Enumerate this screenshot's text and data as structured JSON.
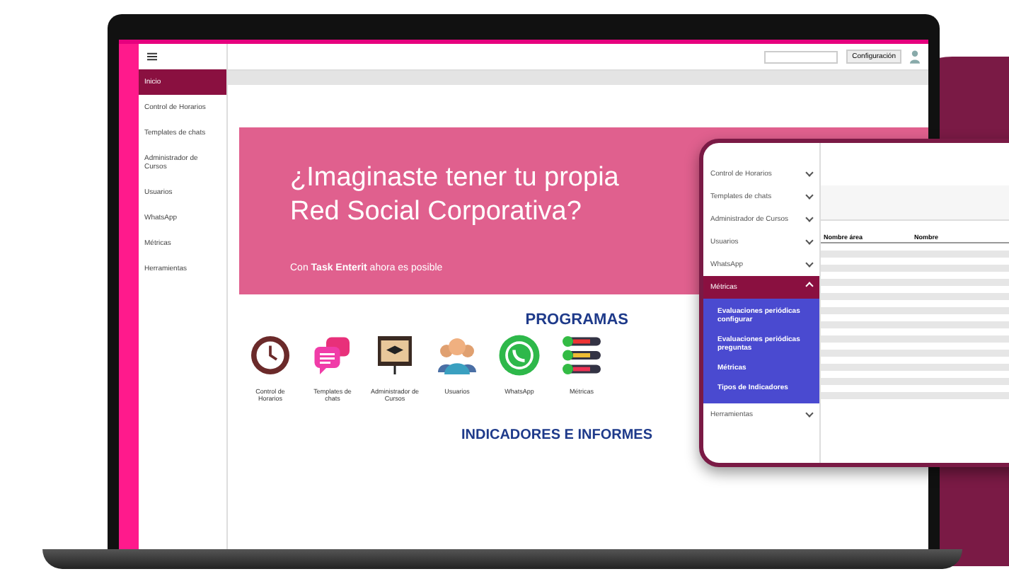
{
  "topbar": {
    "settings_button": "Configuración"
  },
  "sidebar": {
    "items": [
      {
        "label": "Inicio",
        "selected": true
      },
      {
        "label": "Control de Horarios",
        "selected": false
      },
      {
        "label": "Templates de chats",
        "selected": false
      },
      {
        "label": "Administrador de Cursos",
        "selected": false
      },
      {
        "label": "Usuarios",
        "selected": false
      },
      {
        "label": "WhatsApp",
        "selected": false
      },
      {
        "label": "Métricas",
        "selected": false
      },
      {
        "label": "Herramientas",
        "selected": false
      }
    ]
  },
  "banner": {
    "title": "¿Imaginaste tener tu propia Red Social Corporativa?",
    "subtitle": "Con **Task Enterit** ahora es posible"
  },
  "programs": {
    "heading": "PROGRAMAS",
    "items": [
      {
        "kind": "clock",
        "label": "Control de Horarios"
      },
      {
        "kind": "chat",
        "label": "Templates de chats"
      },
      {
        "kind": "course",
        "label": "Administrador de Cursos"
      },
      {
        "kind": "users",
        "label": "Usuarios"
      },
      {
        "kind": "whatsapp",
        "label": "WhatsApp"
      },
      {
        "kind": "metrics",
        "label": "Métricas"
      }
    ]
  },
  "indicators": {
    "heading": "INDICADORES E INFORMES"
  },
  "inset": {
    "menu": [
      {
        "label": "Control de Horarios",
        "expanded": false
      },
      {
        "label": "Templates de chats",
        "expanded": false
      },
      {
        "label": "Administrador de Cursos",
        "expanded": false
      },
      {
        "label": "Usuarios",
        "expanded": false
      },
      {
        "label": "WhatsApp",
        "expanded": false
      },
      {
        "label": "Métricas",
        "expanded": true,
        "children": [
          {
            "label": "Evaluaciones periódicas configurar"
          },
          {
            "label": "Evaluaciones periódicas preguntas"
          },
          {
            "label": "Métricas"
          },
          {
            "label": "Tipos de Indicadores"
          }
        ]
      },
      {
        "label": "Herramientas",
        "expanded": false
      }
    ],
    "columns": [
      "Nombre área",
      "Nombre"
    ]
  }
}
